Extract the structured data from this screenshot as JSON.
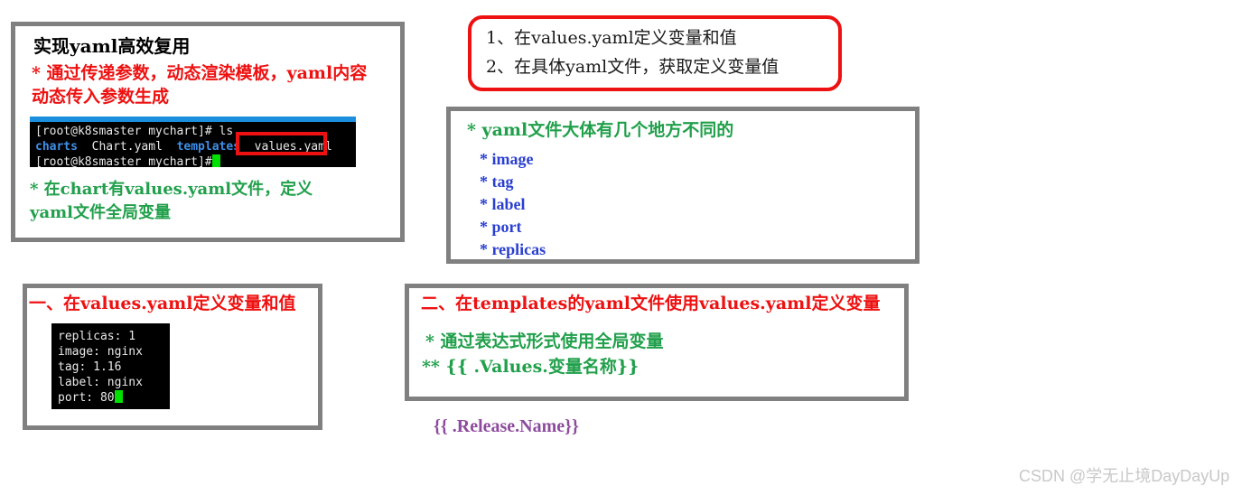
{
  "background_color": "#ffffff",
  "colors": {
    "box_border_gray": "#808080",
    "accent_red": "#ee1111",
    "accent_green": "#21a04b",
    "accent_blue": "#2a3fd0",
    "accent_purple": "#8e4b9e",
    "terminal_bg": "#000000",
    "terminal_titlebar_blue": "#1b8fdd",
    "terminal_dir_blue": "#3f8fe8",
    "terminal_text_white": "#e8e8e8",
    "cursor_green": "#00e000",
    "watermark_gray": "#c8c8c8"
  },
  "box_intro": {
    "title": "实现yaml高效复用",
    "bullet_line1": "* 通过传递参数，动态渲染模板，yaml内容",
    "bullet_line2": "动态传入参数生成",
    "terminal": {
      "line1": "[root@k8smaster mychart]# ls",
      "line2_parts": {
        "charts": "charts",
        "chart_yaml": "Chart.yaml",
        "templates": "templates",
        "values_yaml": "values.yaml"
      },
      "line3": "[root@k8smaster mychart]#",
      "highlight_target": "values.yaml"
    },
    "note_line1": "* 在chart有values.yaml文件，定义",
    "note_line2": "yaml文件全局变量"
  },
  "box_steps": {
    "item1": "1、在values.yaml定义变量和值",
    "item2": "2、在具体yaml文件，获取定义变量值"
  },
  "box_diffs": {
    "heading": "* yaml文件大体有几个地方不同的",
    "items": [
      "* image",
      "* tag",
      "* label",
      "* port",
      "* replicas"
    ]
  },
  "box_values": {
    "heading": "一、在values.yaml定义变量和值",
    "terminal_lines": [
      "replicas: 1",
      "image: nginx",
      "tag: 1.16",
      "label: nginx",
      "port: 80"
    ]
  },
  "box_templates": {
    "heading": "二、在templates的yaml文件使用values.yaml定义变量",
    "line1": "* 通过表达式形式使用全局变量",
    "line2": "** {{ .Values.变量名称}}"
  },
  "release_expression": "{{ .Release.Name}}",
  "watermark": "CSDN @学无止境DayDayUp"
}
